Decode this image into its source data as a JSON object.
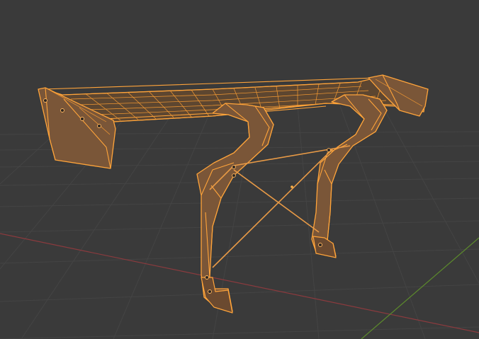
{
  "viewport": {
    "mode": "edit-mode-wireframe",
    "background_color": "#3a3a3a",
    "grid_color": "#444444",
    "axis_x_color": "#8b3a3e",
    "axis_y_color": "#5c8a2c",
    "selection_color": "#ffa43a",
    "object": {
      "name_icon": "mesh-object-icon",
      "kind": "rear-wing-spoiler",
      "selected": true
    }
  }
}
